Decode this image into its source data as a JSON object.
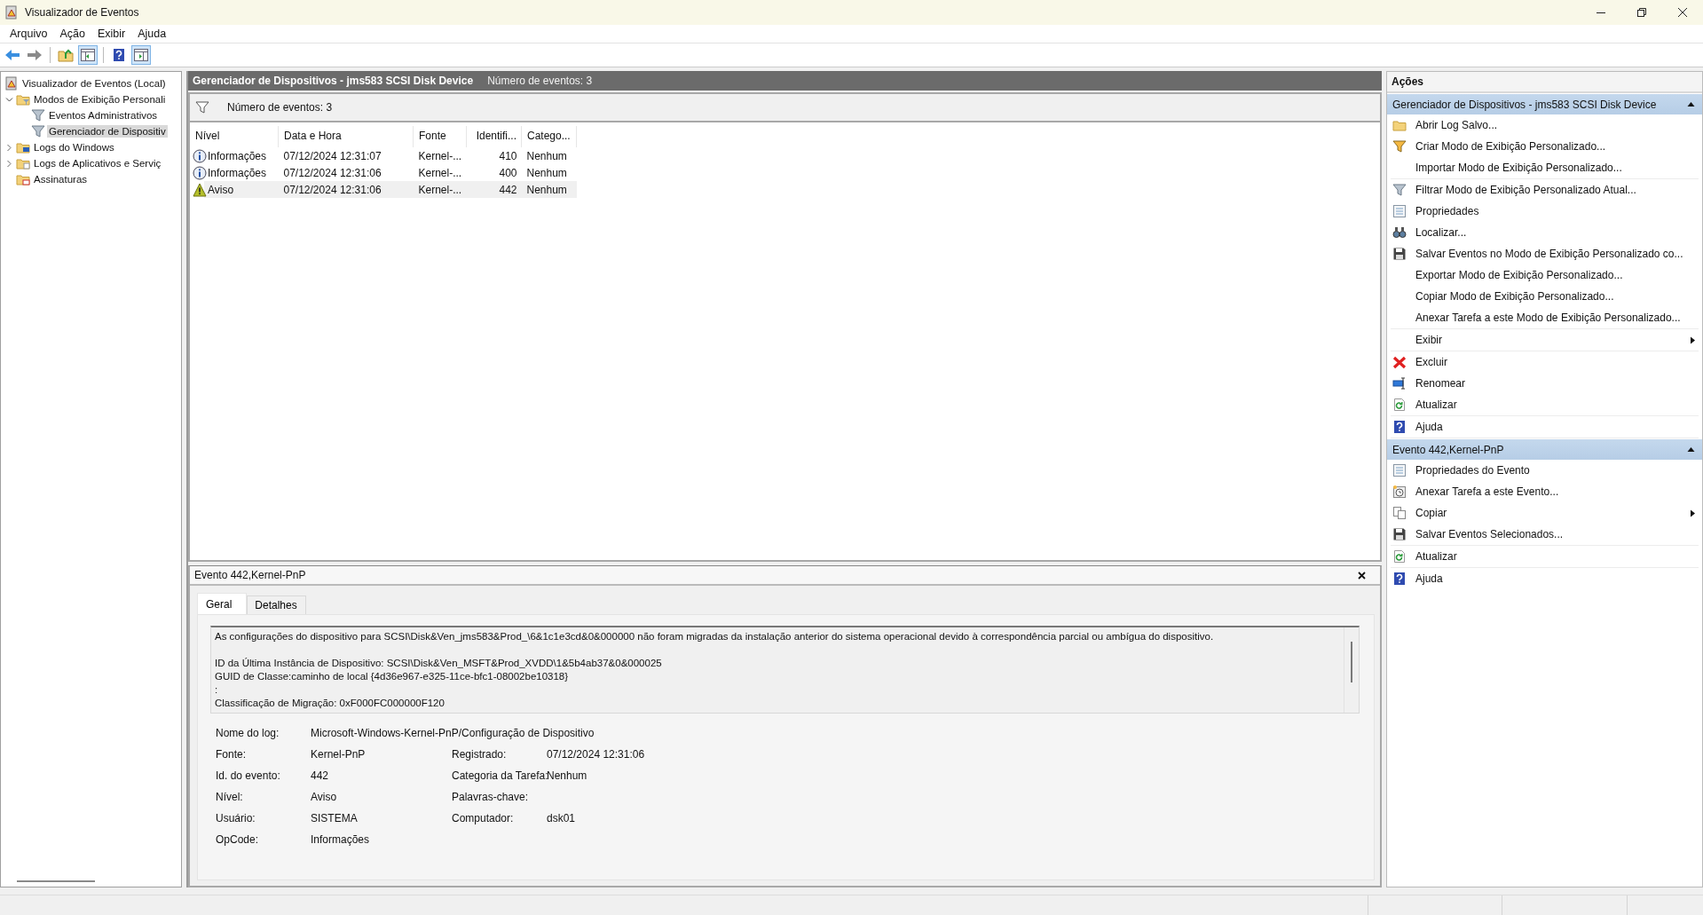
{
  "window": {
    "title": "Visualizador de Eventos"
  },
  "menu": [
    "Arquivo",
    "Ação",
    "Exibir",
    "Ajuda"
  ],
  "toolbar": [
    [
      {
        "kind": "back",
        "pressed": false
      },
      {
        "kind": "forward",
        "pressed": false
      }
    ],
    [
      {
        "kind": "up",
        "pressed": false
      },
      {
        "kind": "pane",
        "pressed": true
      }
    ],
    [
      {
        "kind": "help",
        "pressed": false
      },
      {
        "kind": "pane2",
        "pressed": true
      }
    ]
  ],
  "tree": [
    {
      "label": "Visualizador de Eventos (Local)",
      "kind": "viewer",
      "selected": false,
      "children": [
        {
          "label": "Modos de Exibição Personali",
          "kind": "folder-filter",
          "expanded": true,
          "selected": false,
          "children": [
            {
              "label": "Eventos Administrativos",
              "kind": "filter",
              "selected": false
            },
            {
              "label": "Gerenciador de Dispositiv",
              "kind": "filter",
              "selected": true
            }
          ]
        },
        {
          "label": "Logs do Windows",
          "kind": "folder-pc",
          "expanded": false,
          "selected": false
        },
        {
          "label": "Logs de Aplicativos e Serviç",
          "kind": "folder-doc",
          "expanded": false,
          "selected": false
        },
        {
          "label": "Assinaturas",
          "kind": "folder-sub",
          "selected": false
        }
      ]
    }
  ],
  "header": {
    "title": "Gerenciador de Dispositivos - jms583  SCSI Disk Device",
    "count": "Número de eventos: 3"
  },
  "filter_bar": {
    "text": "Número de eventos: 3"
  },
  "table": {
    "columns": [
      "Nível",
      "Data e Hora",
      "Fonte",
      "Identifi...",
      "Catego..."
    ],
    "rows": [
      {
        "kind": "info",
        "selected": false,
        "cells": [
          "Informações",
          "07/12/2024 12:31:07",
          "Kernel-...",
          "410",
          "Nenhum"
        ]
      },
      {
        "kind": "info",
        "selected": false,
        "cells": [
          "Informações",
          "07/12/2024 12:31:06",
          "Kernel-...",
          "400",
          "Nenhum"
        ]
      },
      {
        "kind": "warning",
        "selected": true,
        "cells": [
          "Aviso",
          "07/12/2024 12:31:06",
          "Kernel-...",
          "442",
          "Nenhum"
        ]
      }
    ]
  },
  "details": {
    "title": "Evento 442,Kernel-PnP",
    "tabs": [
      {
        "label": "Geral",
        "selected": true
      },
      {
        "label": "Detalhes",
        "selected": false
      }
    ],
    "message": [
      [
        "As configurações do dispositivo para SCSI\\Disk&Ven_jms583&Prod_\\6&1c1e3cd&0&000000 não foram migradas da instalação anterior do sistema operacional devido à correspondência parcial ou ambígua do dispositivo."
      ],
      [
        "ID da Última Instância de Dispositivo: SCSI\\Disk&Ven_MSFT&Prod_XVDD\\1&5b4ab37&0&000025",
        "GUID de Classe:caminho de local  {4d36e967-e325-11ce-bfc1-08002be10318}",
        ":",
        "Classificação de Migração: 0xF000FC000000F120"
      ]
    ],
    "fields": [
      [
        {
          "label": "Nome do log:",
          "value": "Microsoft-Windows-Kernel-PnP/Configuração de Dispositivo"
        }
      ],
      [
        {
          "label": "Fonte:",
          "value": "Kernel-PnP"
        },
        {
          "label": "Registrado:",
          "value": "07/12/2024 12:31:06"
        }
      ],
      [
        {
          "label": "Id. do evento:",
          "value": "442"
        },
        {
          "label": "Categoria da Tarefa:",
          "value": "Nenhum"
        }
      ],
      [
        {
          "label": "Nível:",
          "value": "Aviso"
        },
        {
          "label": "Palavras-chave:"
        }
      ],
      [
        {
          "label": "Usuário:",
          "value": "SISTEMA"
        },
        {
          "label": "Computador:",
          "value": "dsk01"
        }
      ],
      [
        {
          "label": "OpCode:",
          "value": "Informações"
        }
      ]
    ]
  },
  "actions": {
    "title": "Ações",
    "sections": [
      {
        "title": "Gerenciador de Dispositivos - jms583  SCSI Disk Device",
        "expanded": true,
        "groups": [
          [
            {
              "label": "Abrir Log Salvo...",
              "kind": "folder",
              "submenu": false
            },
            {
              "label": "Criar Modo de Exibição Personalizado...",
              "kind": "funnel-new",
              "submenu": false
            },
            {
              "label": "Importar Modo de Exibição Personalizado...",
              "kind": "none",
              "submenu": false
            }
          ],
          [
            {
              "label": "Filtrar Modo de Exibição Personalizado Atual...",
              "kind": "funnel",
              "submenu": false
            },
            {
              "label": "Propriedades",
              "kind": "properties",
              "submenu": false
            },
            {
              "label": "Localizar...",
              "kind": "binoculars",
              "submenu": false
            },
            {
              "label": "Salvar Eventos no Modo de Exibição Personalizado co...",
              "kind": "disk",
              "submenu": false
            },
            {
              "label": "Exportar Modo de Exibição Personalizado...",
              "kind": "none",
              "submenu": false
            },
            {
              "label": "Copiar Modo de Exibição Personalizado...",
              "kind": "none",
              "submenu": false
            },
            {
              "label": "Anexar Tarefa a este Modo de Exibição Personalizado...",
              "kind": "none",
              "submenu": false
            }
          ],
          [
            {
              "label": "Exibir",
              "kind": "none",
              "submenu": true
            }
          ],
          [
            {
              "label": "Excluir",
              "kind": "delete",
              "submenu": false
            },
            {
              "label": "Renomear",
              "kind": "rename",
              "submenu": false
            },
            {
              "label": "Atualizar",
              "kind": "refresh",
              "submenu": false
            }
          ],
          [
            {
              "label": "Ajuda",
              "kind": "help",
              "submenu": false
            }
          ]
        ]
      },
      {
        "title": "Evento 442,Kernel-PnP",
        "expanded": true,
        "groups": [
          [
            {
              "label": "Propriedades do Evento",
              "kind": "properties",
              "submenu": false
            },
            {
              "label": "Anexar Tarefa a este Evento...",
              "kind": "clock",
              "submenu": false
            },
            {
              "label": "Copiar",
              "kind": "copy",
              "submenu": true
            },
            {
              "label": "Salvar Eventos Selecionados...",
              "kind": "disk",
              "submenu": false
            }
          ],
          [
            {
              "label": "Atualizar",
              "kind": "refresh",
              "submenu": false
            }
          ],
          [
            {
              "label": "Ajuda",
              "kind": "help",
              "submenu": false
            }
          ]
        ]
      }
    ]
  }
}
